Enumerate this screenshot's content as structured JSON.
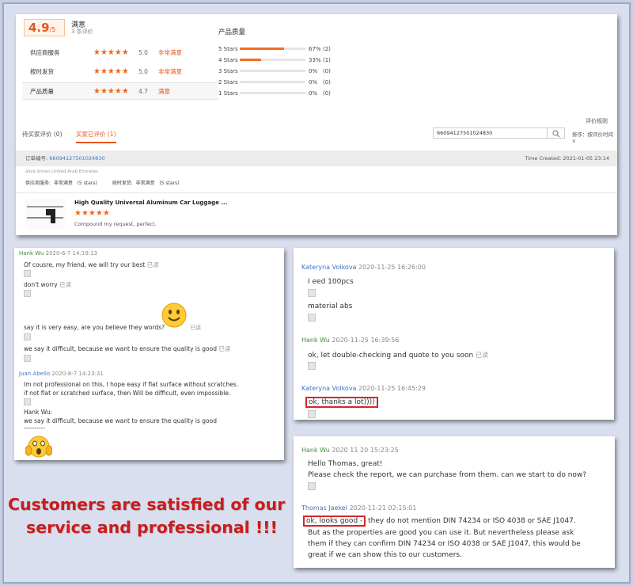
{
  "summary": {
    "score": "4.9",
    "score_suffix": "/5",
    "satisfaction_label": "满意",
    "review_count": "3 条评价",
    "criteria": [
      {
        "name": "供应商服务",
        "value": "5.0",
        "word": "非常满意",
        "stars": 5
      },
      {
        "name": "按时发货",
        "value": "5.0",
        "word": "非常满意",
        "stars": 5
      },
      {
        "name": "产品质量",
        "value": "4.7",
        "word": "满意",
        "stars": 4.7
      }
    ],
    "quality_title": "产品质量",
    "distribution": [
      {
        "label": "5 Stars",
        "pct": "67%",
        "count": "(2)",
        "fraction": 0.67
      },
      {
        "label": "4 Stars",
        "pct": "33%",
        "count": "(1)",
        "fraction": 0.33
      },
      {
        "label": "3 Stars",
        "pct": "0%",
        "count": "(0)",
        "fraction": 0
      },
      {
        "label": "2 Stars",
        "pct": "0%",
        "count": "(0)",
        "fraction": 0
      },
      {
        "label": "1 Stars",
        "pct": "0%",
        "count": "(0)",
        "fraction": 0
      }
    ],
    "rules_link": "评价规则",
    "tabs": [
      {
        "label": "待买家评价 (0)",
        "active": false
      },
      {
        "label": "买家已评价 (1)",
        "active": true
      }
    ],
    "search_value": "66094127501024830",
    "sort_label": "排序：按评价时间 ∨",
    "order_label": "订单编号:",
    "order_number": "66094127501024830",
    "time_created": "Time Created: 2021-01-05 23:14",
    "buyer": "aliza lomen,United Arab Emirates",
    "buyer_ratings": "供应商服务:  非常满意   (5 stars)          按时发货:  非常满意   (5 stars)",
    "product_title": "High Quality Universal Aluminum Car Luggage ...",
    "product_review": "Compound my request, perfect.",
    "product_stars": "★★★★★"
  },
  "chat_left": {
    "msg1_sender": "Hank Wu",
    "msg1_time": "2020-6-7 14:19:13",
    "msg1_lines": [
      "Of cousre, my friend, we will try our best",
      "don't worry",
      "say it is very easy, are you believe they words?",
      "we say it difficult, because we want to ensure the quality is good"
    ],
    "read_mark": "已读",
    "msg2_sender": "Juan Abello",
    "msg2_time": "2020-8-7 14:23:31",
    "msg2_lines": [
      "Im not professional on this, I hope easy if flat surface without scratches.",
      "if not flat or scratched surface, then Will be difficult, even impossible."
    ],
    "quote_lines": [
      "Hank Wu:",
      "we say it difficult, because we want to ensure the quality is good",
      "----------"
    ]
  },
  "chat_right1": {
    "m1_sender": "Kateryna Volkova",
    "m1_time": "2020-11-25 16:26:00",
    "m1_lines": [
      "I eed 100pcs",
      "material abs"
    ],
    "m2_sender": "Hank Wu",
    "m2_time": "2020-11-25 16:39:56",
    "m2_text": "ok, let double-checking and quote to you soon",
    "read_mark": "已读",
    "m3_sender": "Kateryna Volkova",
    "m3_time": "2020-11-25 16:45:29",
    "m3_text": "ok, thanks a lot))))"
  },
  "chat_right2": {
    "m1_sender": "Hank Wu",
    "m1_time": "2020 11 20 15:23:25",
    "m1_lines": [
      "Hello Thomas, great!",
      "Please check the report, we can purchase from them. can we start to do now?"
    ],
    "m2_sender": "Thomas Jaekel",
    "m2_time": "2020-11-21 02:15:01",
    "m2_highlight": "ok, looks good -",
    "m2_rest": " they do not mention DIN 74234 or ISO 4038 or SAE J1047.",
    "m2_lines": [
      "But as the properties are good you can use it. But nevertheless please ask",
      "them if they can confirm DIN 74234 or ISO 4038 or SAE J1047, this would be",
      "great if we can show this to our customers."
    ]
  },
  "slogan": {
    "line1": "Customers are satisfied of our",
    "line2": "service and professional !!!"
  },
  "colors": {
    "accent": "#e8561b",
    "slogan": "#cc1b1b",
    "highlight_box": "#d6262a"
  }
}
